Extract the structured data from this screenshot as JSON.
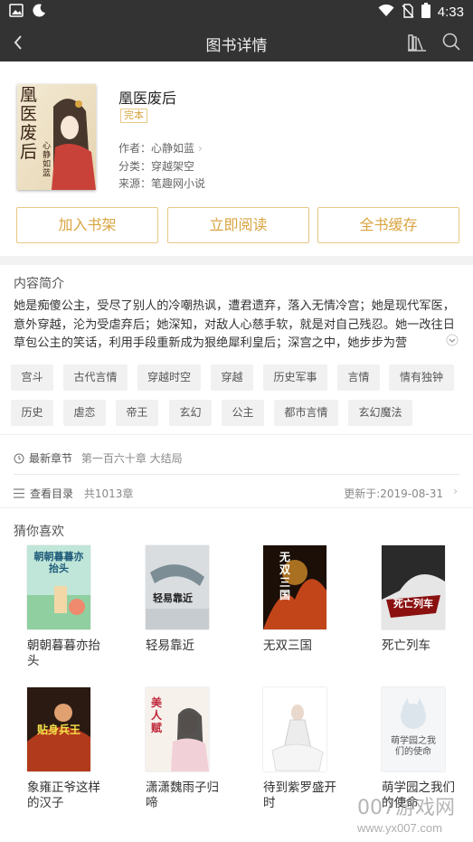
{
  "status_bar": {
    "time": "4:33"
  },
  "header": {
    "title": "图书详情"
  },
  "book": {
    "title": "凰医废后",
    "status_badge": "完本",
    "author_label": "作者：",
    "author": "心静如蓝",
    "category_label": "分类：",
    "category": "穿越架空",
    "source_label": "来源：",
    "source": "笔趣网小说",
    "cover_text": "凰医废后",
    "cover_author": "心静如蓝"
  },
  "actions": {
    "add_shelf": "加入书架",
    "read_now": "立即阅读",
    "cache_all": "全书缓存"
  },
  "intro": {
    "title": "内容简介",
    "text": "她是痴傻公主，受尽了别人的冷嘲热讽，遭君遗弃，落入无情冷宫；她是现代军医，意外穿越，沦为受虐弃后；她深知，对敌人心慈手软，就是对自己残忍。她一改往日草包公主的笑话，利用手段重新成为狠绝犀利皇后；深宫之中，她步步为营"
  },
  "tags": [
    "宫斗",
    "古代言情",
    "穿越时空",
    "穿越",
    "历史军事",
    "言情",
    "情有独钟",
    "历史",
    "虐恋",
    "帝王",
    "玄幻",
    "公主",
    "都市言情",
    "玄幻魔法"
  ],
  "latest": {
    "label": "最新章节",
    "chapter": "第一百六十章 大结局"
  },
  "catalog": {
    "label": "查看目录",
    "count": "共1013章",
    "updated": "更新于:2019-08-31"
  },
  "recommend": {
    "title": "猜你喜欢",
    "books": [
      {
        "name": "朝朝暮暮亦抬头",
        "cover": "朝朝暮暮亦抬头"
      },
      {
        "name": "轻易靠近",
        "cover": "轻易靠近"
      },
      {
        "name": "无双三国",
        "cover": "无双三国"
      },
      {
        "name": "死亡列车",
        "cover": "死亡列车"
      },
      {
        "name": "象雍正爷这样的汉子",
        "cover": "贴身兵王"
      },
      {
        "name": "潇潇魏雨子归啼",
        "cover": "美人赋"
      },
      {
        "name": "待到紫罗盛开时",
        "cover": ""
      },
      {
        "name": "萌学园之我们的使命",
        "cover": "萌学园之我们的使命"
      }
    ]
  },
  "watermark": {
    "brand": "007游戏网",
    "url": "www.yx007.com"
  },
  "colors": {
    "bar": "#333333",
    "accent": "#d9a441",
    "tag_bg": "#f1f1f1"
  }
}
